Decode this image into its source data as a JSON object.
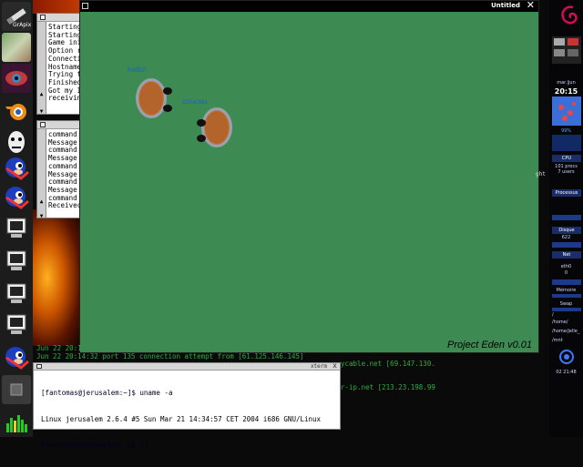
{
  "dock": {
    "items": [
      {
        "name": "grapix",
        "label": "GrApix"
      },
      {
        "name": "photo"
      },
      {
        "name": "eye"
      },
      {
        "name": "blender"
      },
      {
        "name": "face"
      },
      {
        "name": "sonic-1"
      },
      {
        "name": "sonic-2"
      },
      {
        "name": "monitor-1"
      },
      {
        "name": "monitor-2"
      },
      {
        "name": "monitor-3"
      },
      {
        "name": "monitor-4"
      },
      {
        "name": "sonic-3"
      },
      {
        "name": "grey-box"
      },
      {
        "name": "equalizer"
      }
    ]
  },
  "xterm1": {
    "lines": [
      "Starting",
      "Starting",
      "Game ini",
      "Option r",
      "Connecti",
      "Hostname",
      "Trying t",
      "Finished",
      "Got my I",
      "receivin"
    ]
  },
  "xterm2": {
    "lines": [
      "command",
      "Message",
      "command",
      "Message",
      "command",
      "Message",
      "command",
      "Message",
      "command",
      "Receivec"
    ]
  },
  "game": {
    "title": "Untitled",
    "close_symbol": "✕",
    "brand": "Project Eden v0.01",
    "players": [
      {
        "speech": "hello!"
      },
      {
        "speech": "coucou"
      }
    ]
  },
  "log": {
    "lines": [
      "Jun 22 20:1",
      "Jun 22 20:14:32 port 135 connection attempt from  [61.125.146.145]"
    ],
    "right_fragments": [
      "ght",
      "ycable.net [69.147.130.",
      "r-ip.net [213.23.198.99"
    ]
  },
  "terminal": {
    "title": "xterm",
    "close_symbol": "x",
    "lines": [
      "[fantomas@jerusalem:~]$ uname -a",
      "Linux jerusalem 2.6.4 #5 Sun Mar 21 14:34:57 CET 2004 i686 GNU/Linux",
      "[fantomas@jerusalem:~]$ []"
    ]
  },
  "right_panel": {
    "date": "mar.|jun",
    "time": "20:15",
    "battery": "99%",
    "cpu": {
      "label": "CPU",
      "procs": "101 procs",
      "users": "7 users"
    },
    "process_label": "Processus",
    "disk": {
      "label": "Disque",
      "value": "622"
    },
    "net_label": "Net",
    "eth": {
      "label": "eth0",
      "value": "0"
    },
    "memory_label": "Mémoire",
    "swap_label": "Swap",
    "mounts": [
      "/",
      "/home/",
      "/home/jelle_",
      "/mnt"
    ],
    "clock_bottom": "02 21:48"
  },
  "colors": {
    "game_bg": "#3d8b52",
    "speech": "#1e5fcf",
    "log_green": "#2fae3d"
  }
}
